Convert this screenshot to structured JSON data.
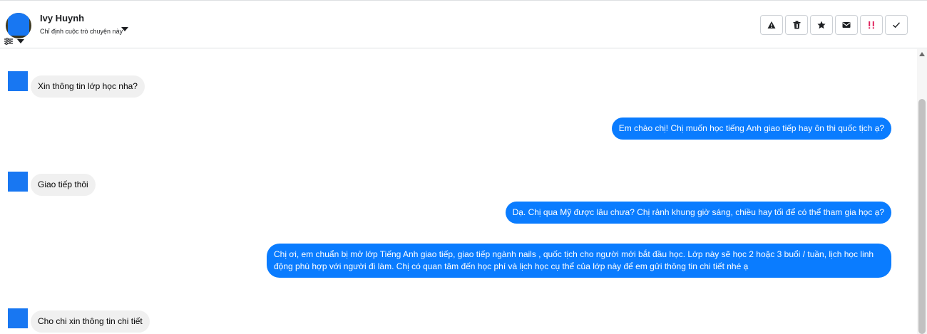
{
  "header": {
    "contact_name": "Ivy Huynh",
    "assign_label": "Chỉ định cuộc trò chuyện này"
  },
  "actions": [
    {
      "icon": "warning-icon"
    },
    {
      "icon": "trash-icon"
    },
    {
      "icon": "star-icon"
    },
    {
      "icon": "mail-icon"
    },
    {
      "icon": "spam-icon",
      "color": "#e0245e"
    },
    {
      "icon": "check-icon"
    }
  ],
  "messages": [
    {
      "direction": "incoming",
      "text": "Xin thông tin lớp học nha?"
    },
    {
      "direction": "outgoing",
      "text": "Em chào chị! Chị muốn học tiếng Anh giao tiếp hay ôn thi quốc tịch ạ?"
    },
    {
      "direction": "incoming",
      "text": "Giao tiếp thôi"
    },
    {
      "direction": "outgoing",
      "text": "Dạ. Chị qua Mỹ được lâu chưa? Chị rảnh khung giờ sáng, chiều hay tối để có thể tham gia học ạ?"
    },
    {
      "direction": "outgoing",
      "text": "Chị ơi, em chuẩn bị mở lớp Tiếng Anh giao tiếp, giao tiếp ngành nails , quốc tịch cho người mới bắt đầu học. Lớp này sẽ học 2 hoặc 3 buổi / tuần, lịch học linh động phù hợp với người đi làm. Chị có quan tâm đến học phí và lịch học cụ thể của lớp này để em  gửi thông tin chi tiết nhé ạ"
    },
    {
      "direction": "incoming",
      "text": "Cho chi xin thông tin chi tiết"
    }
  ],
  "colors": {
    "outgoing_bubble": "#0a7cff",
    "incoming_bubble": "#f0f0f0",
    "avatar_placeholder": "#1877f2"
  }
}
